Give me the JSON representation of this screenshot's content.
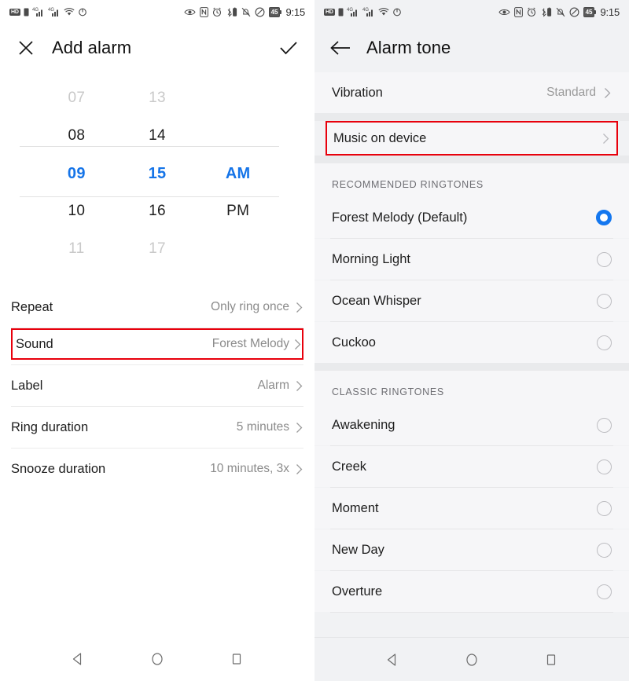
{
  "status_bar": {
    "left_icons": [
      "hd-badge-icon",
      "sim-icon",
      "signal-bars-1-icon",
      "signal-bars-2-icon",
      "wifi-icon",
      "data-saver-icon"
    ],
    "right_icons": [
      "eye-comfort-icon",
      "nfc-icon",
      "alarm-clock-icon",
      "bluetooth-battery-icon",
      "ringer-muted-icon",
      "do-not-disturb-icon"
    ],
    "hd_label": "HD",
    "battery_level": "45",
    "time": "9:15"
  },
  "left_screen": {
    "appbar": {
      "close_icon": "close-icon",
      "title": "Add alarm",
      "confirm_icon": "check-icon"
    },
    "time_picker": {
      "hours": [
        "07",
        "08",
        "09",
        "10",
        "11"
      ],
      "minutes": [
        "13",
        "14",
        "15",
        "16",
        "17"
      ],
      "meridiem": [
        "",
        "",
        "AM",
        "PM",
        ""
      ],
      "selected_index": 2,
      "selected_hour": "09",
      "selected_minute": "15",
      "selected_meridiem": "AM",
      "selected_color": "#1574e8"
    },
    "settings": [
      {
        "label": "Repeat",
        "value": "Only ring once",
        "highlighted": false
      },
      {
        "label": "Sound",
        "value": "Forest Melody",
        "highlighted": true
      },
      {
        "label": "Label",
        "value": "Alarm",
        "highlighted": false
      },
      {
        "label": "Ring duration",
        "value": "5 minutes",
        "highlighted": false
      },
      {
        "label": "Snooze duration",
        "value": "10 minutes, 3x",
        "highlighted": false
      }
    ]
  },
  "right_screen": {
    "appbar": {
      "back_icon": "back-arrow-icon",
      "title": "Alarm tone"
    },
    "vibration_row": {
      "label": "Vibration",
      "value": "Standard"
    },
    "music_on_device_row": {
      "label": "Music on device",
      "value": "",
      "highlighted": true
    },
    "sections": [
      {
        "header": "RECOMMENDED RINGTONES",
        "items": [
          {
            "label": "Forest Melody (Default)",
            "selected": true
          },
          {
            "label": "Morning Light",
            "selected": false
          },
          {
            "label": "Ocean Whisper",
            "selected": false
          },
          {
            "label": "Cuckoo",
            "selected": false
          }
        ]
      },
      {
        "header": "CLASSIC RINGTONES",
        "items": [
          {
            "label": "Awakening",
            "selected": false
          },
          {
            "label": "Creek",
            "selected": false
          },
          {
            "label": "Moment",
            "selected": false
          },
          {
            "label": "New Day",
            "selected": false
          },
          {
            "label": "Overture",
            "selected": false
          }
        ]
      }
    ]
  },
  "nav_bar": {
    "back_icon": "nav-back-triangle-icon",
    "home_icon": "nav-home-circle-icon",
    "recents_icon": "nav-recents-square-icon"
  },
  "accent_colors": {
    "blue": "#1477ef",
    "highlight_red": "#e8000c",
    "right_bg": "#f1f2f4",
    "row_bg": "#f6f6f8"
  }
}
